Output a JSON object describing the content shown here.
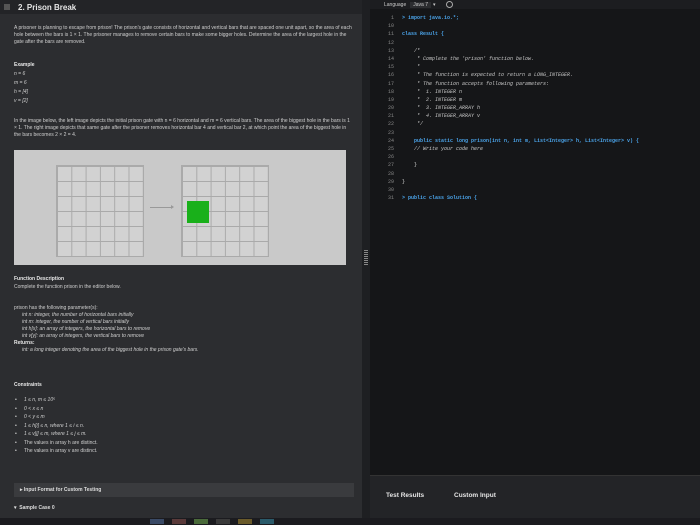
{
  "problem": {
    "title": "2. Prison Break",
    "statement": "A prisoner is planning to escape from prison! The prison's gate consists of horizontal and vertical bars that are spaced one unit apart, so the area of each hole between the bars is 1 × 1. The prisoner manages to remove certain bars to make some bigger holes. Determine the area of the largest hole in the gate after the bars are removed.",
    "example_heading": "Example",
    "example_lines": [
      "n = 6",
      "m = 6",
      "h = [4]",
      "v = [2]"
    ],
    "explanation": "In the image below, the left image depicts the initial prison gate with n = 6 horizontal and m = 6 vertical bars. The area of the biggest hole in the bars is 1 × 1. The right image depicts that same gate after the prisoner removes horizontal bar 4 and vertical bar 2, at which point the area of the biggest hole in the bars becomes 2 × 2 = 4.",
    "function_desc_heading": "Function Description",
    "function_desc": "Complete the function prison in the editor below.",
    "params_intro": "prison has the following parameter(s):",
    "params": [
      "int n: integer, the number of horizontal bars initially",
      "int m: integer, the number of vertical bars initially",
      "int h[x]: an array of integers, the horizontal bars to remove",
      "int v[y]: an array of integers, the vertical bars to remove"
    ],
    "returns_label": "Returns:",
    "returns": "int: a long integer denoting the area of the biggest hole in the prison gate's bars.",
    "constraints_heading": "Constraints",
    "constraints": [
      "1 ≤ n, m ≤ 10⁵",
      "0 < x ≤ n",
      "0 < y ≤ m",
      "1 ≤ h[i] ≤ n, where 1 ≤ i ≤ n.",
      "1 ≤ v[j] ≤ m, where 1 ≤ j ≤ m.",
      "The values in array h are distinct.",
      "The values in array v are distinct."
    ],
    "input_format_label": "Input Format for Custom Testing",
    "sample_case_label": "Sample Case 0"
  },
  "editor": {
    "language_label": "Language",
    "language_value": "Java 7",
    "code_lines": [
      {
        "n": "1",
        "text": "> import java.io.*;"
      },
      {
        "n": "10",
        "text": ""
      },
      {
        "n": "11",
        "text": "class Result {"
      },
      {
        "n": "12",
        "text": ""
      },
      {
        "n": "13",
        "text": "    /*"
      },
      {
        "n": "14",
        "text": "     * Complete the 'prison' function below."
      },
      {
        "n": "15",
        "text": "     *"
      },
      {
        "n": "16",
        "text": "     * The function is expected to return a LONG_INTEGER."
      },
      {
        "n": "17",
        "text": "     * The function accepts following parameters:"
      },
      {
        "n": "18",
        "text": "     *  1. INTEGER n"
      },
      {
        "n": "19",
        "text": "     *  2. INTEGER m"
      },
      {
        "n": "20",
        "text": "     *  3. INTEGER_ARRAY h"
      },
      {
        "n": "21",
        "text": "     *  4. INTEGER_ARRAY v"
      },
      {
        "n": "22",
        "text": "     */"
      },
      {
        "n": "23",
        "text": ""
      },
      {
        "n": "24",
        "text": "    public static long prison(int n, int m, List<Integer> h, List<Integer> v) {"
      },
      {
        "n": "25",
        "text": "    // Write your code here"
      },
      {
        "n": "26",
        "text": ""
      },
      {
        "n": "27",
        "text": "    }"
      },
      {
        "n": "28",
        "text": ""
      },
      {
        "n": "29",
        "text": "}"
      },
      {
        "n": "30",
        "text": ""
      },
      {
        "n": "31",
        "text": "> public class Solution {"
      }
    ],
    "test_results_label": "Test Results",
    "custom_input_label": "Custom Input"
  },
  "colors": {
    "hole": "#19b01a",
    "keyword": "#4aa3e8"
  }
}
